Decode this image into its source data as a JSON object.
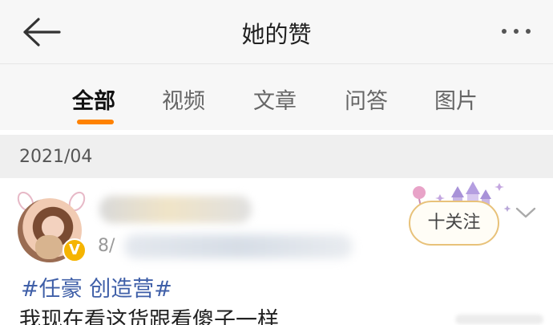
{
  "header": {
    "title": "她的赞",
    "back_icon": "arrow-left-icon",
    "more_icon": "ellipsis-icon"
  },
  "tabs": [
    {
      "label": "全部",
      "active": true
    },
    {
      "label": "视频",
      "active": false
    },
    {
      "label": "文章",
      "active": false
    },
    {
      "label": "问答",
      "active": false
    },
    {
      "label": "图片",
      "active": false
    }
  ],
  "accent_color": "#ff8200",
  "section": {
    "date": "2021/04"
  },
  "post": {
    "time_prefix": "8/",
    "follow_label": "十关注",
    "topic": "#任豪 创造营#",
    "text": "我现在看这货跟看傻子一样",
    "verified_badge": "V"
  }
}
